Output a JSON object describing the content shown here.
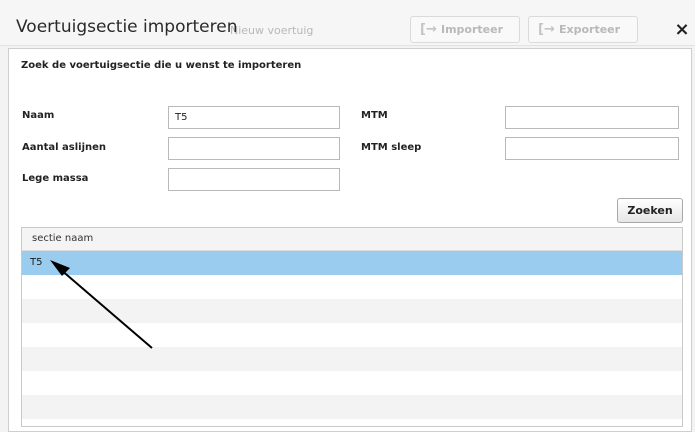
{
  "background": {
    "breadcrumb": "Nieuw voertuig",
    "import_label": "Importeer",
    "export_label": "Exporteer",
    "import_icon": "import-icon",
    "export_icon": "export-icon"
  },
  "dialog": {
    "title": "Voertuigsectie importeren",
    "close_label": "×",
    "instruction": "Zoek de voertuigsectie die u wenst te importeren",
    "fields": {
      "naam": {
        "label": "Naam",
        "value": "T5"
      },
      "aantal_aslijnen": {
        "label": "Aantal aslijnen",
        "value": ""
      },
      "lege_massa": {
        "label": "Lege massa",
        "value": ""
      },
      "mtm": {
        "label": "MTM",
        "value": ""
      },
      "mtm_sleep": {
        "label": "MTM sleep",
        "value": ""
      }
    },
    "search_label": "Zoeken",
    "table": {
      "column_header": "sectie naam",
      "rows": [
        "T5"
      ],
      "selected_color": "#99ccef"
    }
  }
}
